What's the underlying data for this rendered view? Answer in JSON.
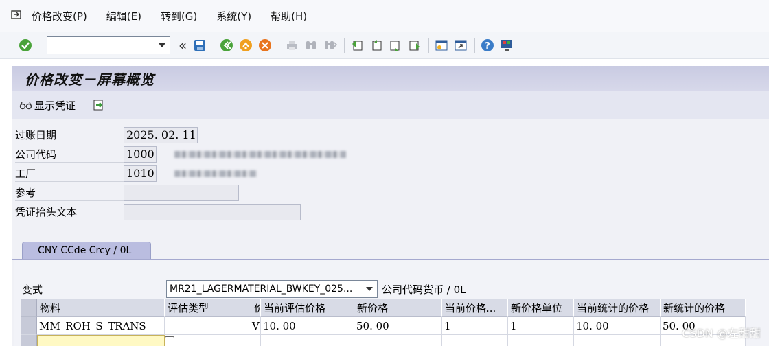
{
  "menu": {
    "items": [
      "价格改变(P)",
      "编辑(E)",
      "转到(G)",
      "系统(Y)",
      "帮助(H)"
    ]
  },
  "toolbar": {
    "command_value": "",
    "chevron": "«",
    "icons": [
      "enter-icon",
      "save-icon",
      "back-icon",
      "exit-icon",
      "cancel-icon",
      "print-icon",
      "find-icon",
      "find-next-icon",
      "first-page-icon",
      "prev-page-icon",
      "next-page-icon",
      "last-page-icon",
      "new-session-icon",
      "shortcut-icon",
      "help-icon",
      "layout-icon"
    ]
  },
  "title": "价格改变－屏幕概览",
  "appbar": {
    "show_document": "显示凭证"
  },
  "form": {
    "posting_date": {
      "label": "过账日期",
      "value": "2025. 02. 11"
    },
    "company_code": {
      "label": "公司代码",
      "value": "1000"
    },
    "plant": {
      "label": "工厂",
      "value": "1010"
    },
    "reference": {
      "label": "参考",
      "value": ""
    },
    "header_text": {
      "label": "凭证抬头文本",
      "value": ""
    }
  },
  "tab": {
    "label": "CNY  CCde Crcy / 0L"
  },
  "variant": {
    "label": "变式",
    "value": "MR21_LAGERMATERIAL_BWKEY_025...",
    "currency_note": "公司代码货币 / 0L"
  },
  "table": {
    "columns": [
      "物料",
      "评估类型",
      "价",
      "当前评估价格",
      "新价格",
      "当前价格...",
      "新价格单位",
      "当前统计的价格",
      "新统计的价格"
    ],
    "rows": [
      [
        "MM_ROH_S_TRANS",
        "",
        "V",
        "10. 00",
        "50. 00",
        "1",
        "1",
        "10. 00",
        "50. 00"
      ]
    ]
  },
  "watermark": "CSDN @左甜甜",
  "colors": {
    "title_band": "#c9cbe2",
    "tab": "#babde0",
    "header_cell": "#d8dbe6"
  }
}
